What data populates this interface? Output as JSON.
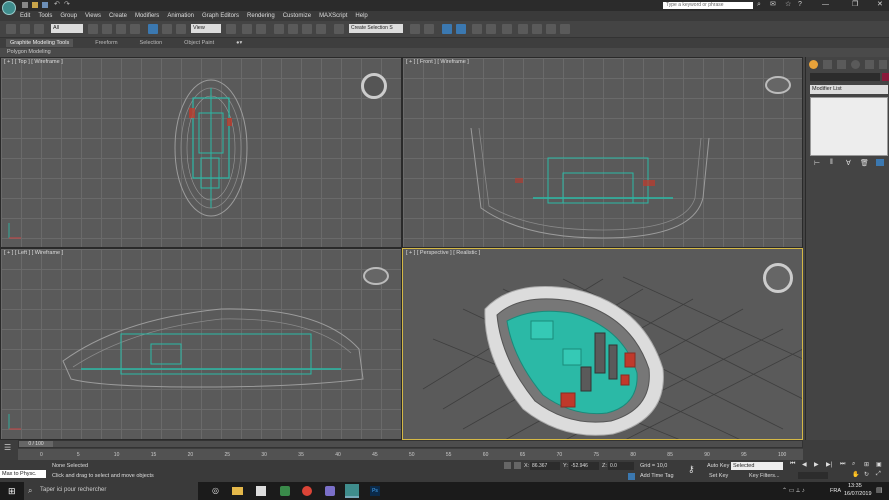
{
  "title_bar": {
    "search_placeholder": "Type a keyword or phrase"
  },
  "menu": [
    "Edit",
    "Tools",
    "Group",
    "Views",
    "Create",
    "Modifiers",
    "Animation",
    "Graph Editors",
    "Rendering",
    "Customize",
    "MAXScript",
    "Help"
  ],
  "toolbar": {
    "selection_filter": "All",
    "view_dropdown": "View",
    "create_selection_set": "Create Selection S"
  },
  "ribbon": {
    "tabs": [
      "Graphite Modeling Tools",
      "Freeform",
      "Selection",
      "Object Paint"
    ],
    "sub_label": "Polygon Modeling"
  },
  "viewports": {
    "top": "[ + ] [ Top ] [ Wireframe ]",
    "front": "[ + ] [ Front ] [ Wireframe ]",
    "left": "[ + ] [ Left ] [ Wireframe ]",
    "perspective": "[ + ] [ Perspective ] [ Realistic ]"
  },
  "command_panel": {
    "modifier_list": "Modifier List"
  },
  "timeline": {
    "frame_counter": "0 / 100",
    "ticks": [
      "0",
      "5",
      "10",
      "15",
      "20",
      "25",
      "30",
      "35",
      "40",
      "45",
      "50",
      "55",
      "60",
      "65",
      "70",
      "75",
      "80",
      "85",
      "90",
      "95",
      "100"
    ]
  },
  "status": {
    "script_listener": "Max to Physc.",
    "selection_status": "None Selected",
    "prompt": "Click and drag to select and move objects",
    "x_label": "X:",
    "x_value": "86.367",
    "y_label": "Y:",
    "y_value": "-52.946",
    "z_label": "Z:",
    "z_value": "0.0",
    "grid": "Grid = 10,0",
    "add_time_tag": "Add Time Tag",
    "auto_key": "Auto Key",
    "set_key": "Set Key",
    "key_mode": "Selected",
    "key_filters": "Key Filters..."
  },
  "taskbar": {
    "search_placeholder": "Taper ici pour rechercher",
    "language": "FRA",
    "time": "13:35",
    "date": "16/07/2019"
  },
  "colors": {
    "accent_teal": "#2bb9a6",
    "highlight_red": "#c0392b",
    "active_border": "#d4b846"
  }
}
